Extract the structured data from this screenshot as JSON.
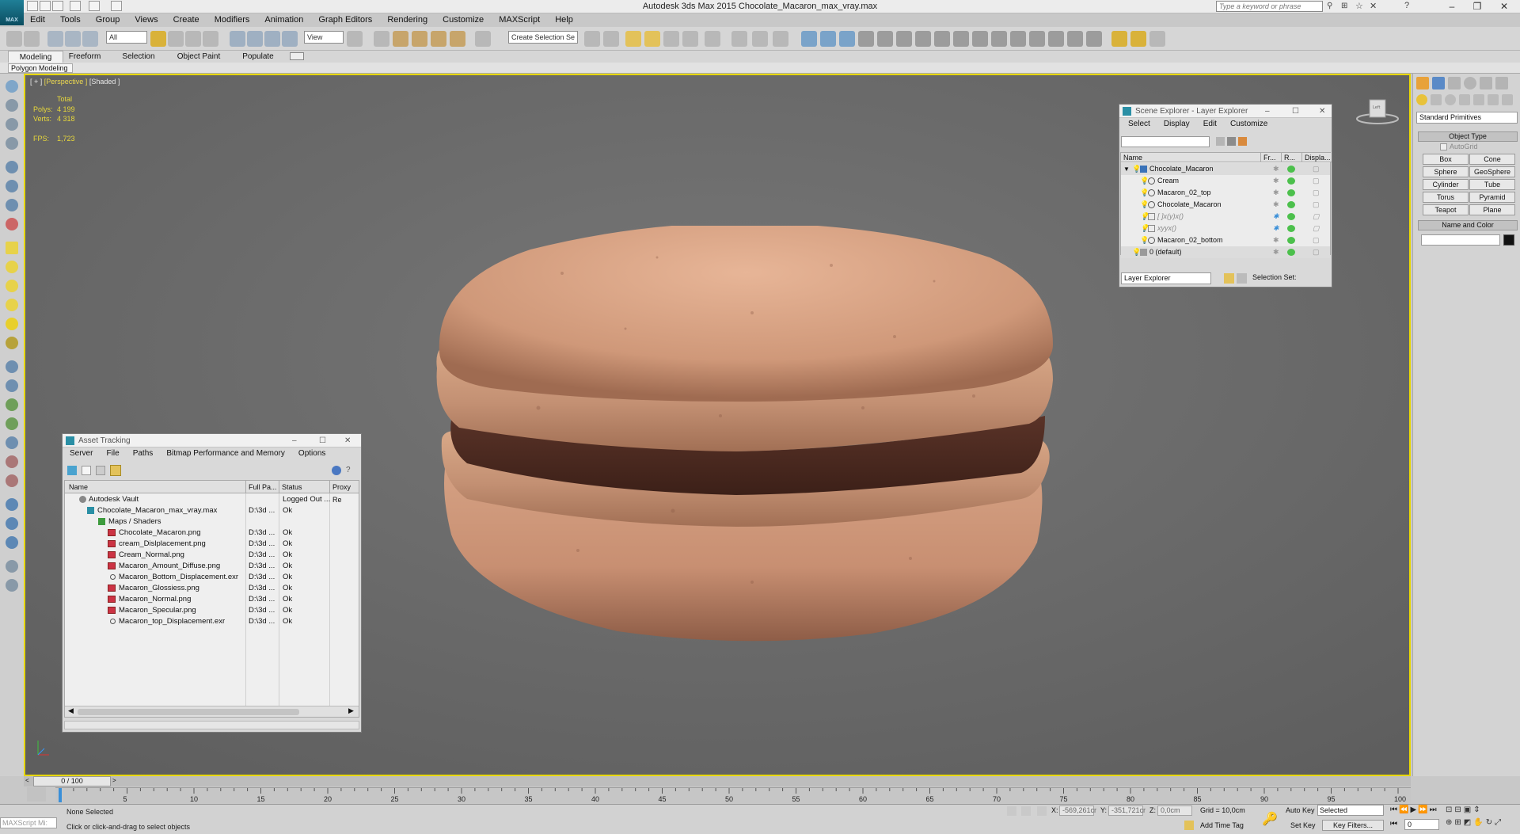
{
  "app": {
    "title": "Autodesk 3ds Max  2015     Chocolate_Macaron_max_vray.max",
    "logo_text": "MAX",
    "search_placeholder": "Type a keyword or phrase"
  },
  "menu": [
    "Edit",
    "Tools",
    "Group",
    "Views",
    "Create",
    "Modifiers",
    "Animation",
    "Graph Editors",
    "Rendering",
    "Customize",
    "MAXScript",
    "Help"
  ],
  "toolbar": {
    "filter_select": "All",
    "ref_coord_select": "View",
    "selection_set_placeholder": "Create Selection Se"
  },
  "ribbon": {
    "tabs": [
      "Modeling",
      "Freeform",
      "Selection",
      "Object Paint",
      "Populate"
    ],
    "sub_label": "Polygon Modeling"
  },
  "viewport": {
    "label_prefix": "[ + ]",
    "label_view": "[Perspective ]",
    "label_shading": "[Shaded ]",
    "stats_header": "Total",
    "polys_label": "Polys:",
    "polys_value": "4 199",
    "verts_label": "Verts:",
    "verts_value": "4 318",
    "fps_label": "FPS:",
    "fps_value": "1,723"
  },
  "scene_explorer": {
    "title": "Scene Explorer - Layer Explorer",
    "menu": [
      "Select",
      "Display",
      "Edit",
      "Customize"
    ],
    "columns": [
      "Name",
      "Fr...",
      "R...",
      "Displa..."
    ],
    "rows": [
      {
        "name": "Chocolate_Macaron",
        "level": 0,
        "kind": "layer"
      },
      {
        "name": "Cream",
        "level": 1,
        "kind": "object"
      },
      {
        "name": "Macaron_02_top",
        "level": 1,
        "kind": "object"
      },
      {
        "name": "Chocolate_Macaron",
        "level": 1,
        "kind": "object"
      },
      {
        "name": "[ ]x(y)x()",
        "level": 1,
        "kind": "hidden"
      },
      {
        "name": "xyyx()",
        "level": 1,
        "kind": "hidden"
      },
      {
        "name": "Macaron_02_bottom",
        "level": 1,
        "kind": "object"
      },
      {
        "name": "0 (default)",
        "level": 0,
        "kind": "layer"
      }
    ],
    "explorer_select": "Layer Explorer",
    "selection_set_label": "Selection Set:"
  },
  "asset_tracking": {
    "title": "Asset Tracking",
    "menu": [
      "Server",
      "File",
      "Paths",
      "Bitmap Performance and Memory",
      "Options"
    ],
    "columns": [
      "Name",
      "Full Pa...",
      "Status",
      "Proxy Re"
    ],
    "rows": [
      {
        "name": "Autodesk Vault",
        "path": "",
        "status": "Logged Out ...",
        "indent": 1
      },
      {
        "name": "Chocolate_Macaron_max_vray.max",
        "path": "D:\\3d ...",
        "status": "Ok",
        "indent": 2
      },
      {
        "name": "Maps / Shaders",
        "path": "",
        "status": "",
        "indent": 3
      },
      {
        "name": "Chocolate_Macaron.png",
        "path": "D:\\3d ...",
        "status": "Ok",
        "indent": 4
      },
      {
        "name": "cream_Dislplacement.png",
        "path": "D:\\3d ...",
        "status": "Ok",
        "indent": 4
      },
      {
        "name": "Cream_Normal.png",
        "path": "D:\\3d ...",
        "status": "Ok",
        "indent": 4
      },
      {
        "name": "Macaron_Amount_Diffuse.png",
        "path": "D:\\3d ...",
        "status": "Ok",
        "indent": 4
      },
      {
        "name": "Macaron_Bottom_Displacement.exr",
        "path": "D:\\3d ...",
        "status": "Ok",
        "indent": 4
      },
      {
        "name": "Macaron_Glossiess.png",
        "path": "D:\\3d ...",
        "status": "Ok",
        "indent": 4
      },
      {
        "name": "Macaron_Normal.png",
        "path": "D:\\3d ...",
        "status": "Ok",
        "indent": 4
      },
      {
        "name": "Macaron_Specular.png",
        "path": "D:\\3d ...",
        "status": "Ok",
        "indent": 4
      },
      {
        "name": "Macaron_top_Displacement.exr",
        "path": "D:\\3d ...",
        "status": "Ok",
        "indent": 4
      }
    ]
  },
  "command_panel": {
    "category_select": "Standard Primitives",
    "object_type_label": "Object Type",
    "autogrid_label": "AutoGrid",
    "primitives": [
      "Box",
      "Cone",
      "Sphere",
      "GeoSphere",
      "Cylinder",
      "Tube",
      "Torus",
      "Pyramid",
      "Teapot",
      "Plane"
    ],
    "name_color_label": "Name and Color"
  },
  "timeline": {
    "frame_label": "0 / 100",
    "ticks": [
      "5",
      "10",
      "15",
      "20",
      "25",
      "30",
      "35",
      "40",
      "45",
      "50",
      "55",
      "60",
      "65",
      "70",
      "75",
      "80",
      "85",
      "90",
      "95",
      "100"
    ]
  },
  "status_bar": {
    "maxscript_label": "MAXScript Mi:",
    "selection_status": "None Selected",
    "prompt": "Click or click-and-drag to select objects",
    "x_label": "X:",
    "x_value": "-569,261cr",
    "y_label": "Y:",
    "y_value": "-351,721cr",
    "z_label": "Z:",
    "z_value": "0,0cm",
    "grid": "Grid = 10,0cm",
    "add_time_tag": "Add Time Tag",
    "auto_key": "Auto Key",
    "set_key": "Set Key",
    "selected_select": "Selected",
    "key_filters": "Key Filters...",
    "frame_value": "0"
  }
}
